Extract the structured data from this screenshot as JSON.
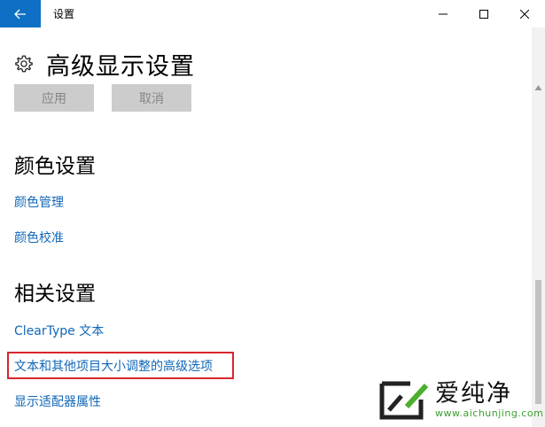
{
  "window": {
    "title": "设置"
  },
  "header": {
    "title": "高级显示设置",
    "icon": "gear-icon"
  },
  "buttons": {
    "apply": "应用",
    "cancel": "取消"
  },
  "sections": {
    "color": {
      "title": "颜色设置",
      "links": [
        "颜色管理",
        "颜色校准"
      ]
    },
    "related": {
      "title": "相关设置",
      "links": [
        "ClearType 文本",
        "文本和其他项目大小调整的高级选项",
        "显示适配器属性"
      ]
    }
  },
  "watermark": {
    "brand": "爱纯净",
    "url": "www.aichunjing.com"
  },
  "colors": {
    "accent": "#0e6fc4",
    "link": "#1167b7",
    "highlight_border": "#d9252d",
    "button_bg": "#cccccc",
    "button_text": "#858585"
  }
}
